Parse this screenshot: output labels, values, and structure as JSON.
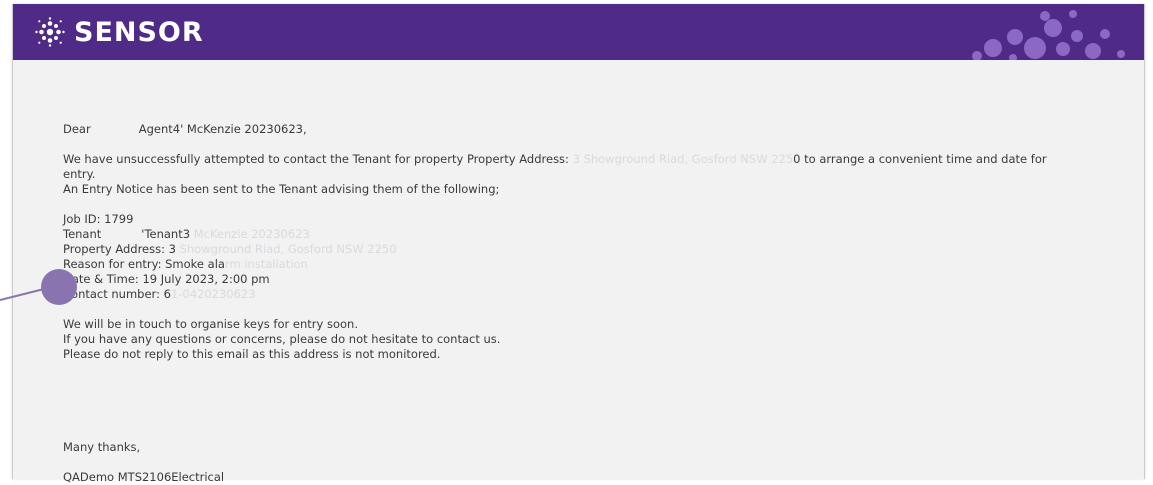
{
  "brand": {
    "name": "SENSOR",
    "color_banner": "#4f2a87",
    "color_dots": "#8a68c4"
  },
  "email": {
    "greeting": "Dear",
    "agent_name": "Agent4' McKenzie 20230623,",
    "p1_a": "We have unsuccessfully attempted to contact the Tenant for property Property Address:",
    "p1_address_faint": " 3 Showground Riad, Gosford NSW 225",
    "p1_b": "0 to arrange a convenient time and date for",
    "p1_c": "entry.",
    "p2": "An Entry Notice has been sent to the Tenant advising them of the following;",
    "details": {
      "job_id": "Job ID: 1799",
      "tenant_label": "Tenant",
      "tenant_value": "'Tenant3",
      "tenant_faint": " McKenzie 20230623",
      "address_label": "Property Address: 3",
      "address_faint": " Showground Riad, Gosford NSW 2250",
      "reason_label": "Reason for entry: Smoke ala",
      "reason_faint": "rm installation",
      "datetime": "Date & Time: 19 July 2023, 2:00 pm",
      "contact_label": "Contact number: 6",
      "contact_faint": "1-0420230623"
    },
    "closing_1": "We will be in touch to organise keys for entry soon.",
    "closing_2": "If you have any questions or concerns, please do not hesitate to contact us.",
    "closing_3": "Please do not reply to this email as this address is not monitored.",
    "signoff": "Many thanks,",
    "signature": "QADemo MTS2106Electrical"
  },
  "annotation": {
    "color": "#8a74b0"
  }
}
